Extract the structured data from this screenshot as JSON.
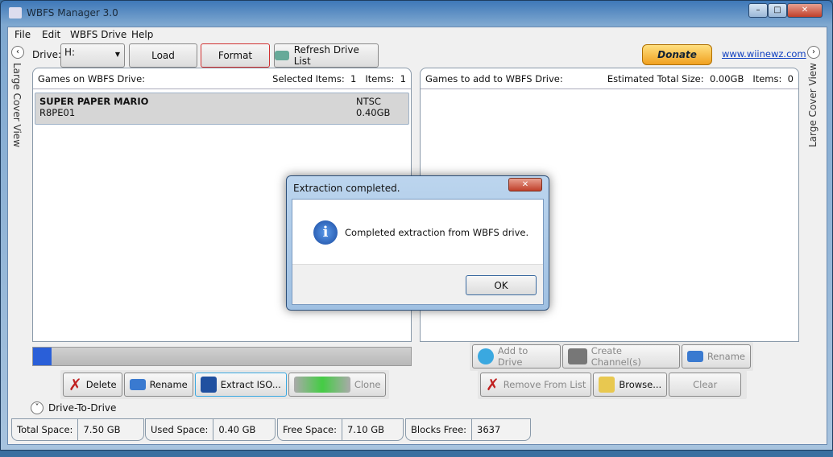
{
  "window": {
    "title": "WBFS Manager 3.0",
    "min": "–",
    "max": "□",
    "close": "✕"
  },
  "menu": [
    "File",
    "Edit",
    "WBFS Drive",
    "Help"
  ],
  "toolbar": {
    "drive_label": "Drive:",
    "drive_value": "H:",
    "load": "Load",
    "format": "Format",
    "refresh": "Refresh Drive List",
    "donate": "Donate",
    "link": "www.wiinewz.com"
  },
  "side": {
    "left": "Large Cover View",
    "right": "Large Cover View"
  },
  "left_panel": {
    "title": "Games on WBFS Drive:",
    "selected_label": "Selected Items:",
    "selected": "1",
    "items_label": "Items:",
    "items": "1",
    "games": [
      {
        "name": "SUPER PAPER MARIO",
        "id": "R8PE01",
        "region": "NTSC",
        "size": "0.40GB"
      }
    ]
  },
  "right_panel": {
    "title": "Games to add to WBFS Drive:",
    "est_label": "Estimated Total Size:",
    "est": "0.00GB",
    "items_label": "Items:",
    "items": "0"
  },
  "progress": {
    "value": 0.05
  },
  "left_buttons": {
    "delete": "Delete",
    "rename": "Rename",
    "extract": "Extract ISO...",
    "clone": "Clone"
  },
  "right_buttons": {
    "add": "Add to Drive",
    "channel": "Create Channel(s)",
    "rename": "Rename",
    "remove": "Remove From List",
    "browse": "Browse...",
    "clear": "Clear"
  },
  "drive_to_drive": "Drive-To-Drive",
  "status": [
    {
      "label": "Total Space:",
      "value": "7.50 GB"
    },
    {
      "label": "Used Space:",
      "value": "0.40 GB"
    },
    {
      "label": "Free Space:",
      "value": "7.10 GB"
    },
    {
      "label": "Blocks Free:",
      "value": "3637"
    }
  ],
  "dialog": {
    "title": "Extraction completed.",
    "message": "Completed extraction from WBFS drive.",
    "ok": "OK",
    "close": "✕"
  }
}
